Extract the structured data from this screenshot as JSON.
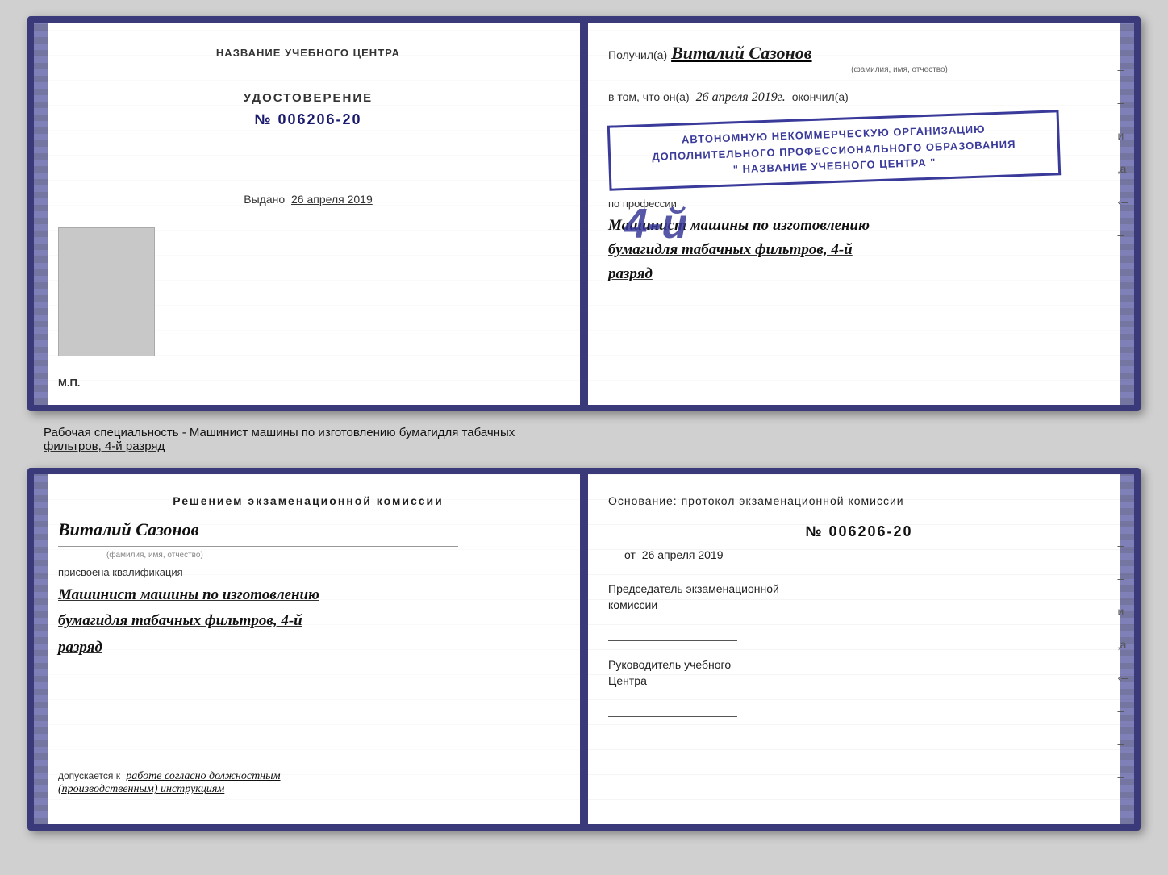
{
  "page": {
    "background_color": "#d0d0d0"
  },
  "top_document": {
    "left_page": {
      "center_label": "НАЗВАНИЕ УЧЕБНОГО ЦЕНТРА",
      "udostoverenie_title": "УДОСТОВЕРЕНИЕ",
      "number": "№ 006206-20",
      "vydano_prefix": "Выдано",
      "vydano_date": "26 апреля 2019",
      "mp_label": "М.П."
    },
    "right_page": {
      "poluchil_prefix": "Получил(а)",
      "poluchil_name": "Виталий Сазонов",
      "fio_subtitle": "(фамилия, имя, отчество)",
      "vtom_prefix": "в том, что он(а)",
      "vtom_date": "26 апреля 2019г.",
      "okonchil": "окончил(а)",
      "stamp_line1": "АВТОНОМНУЮ НЕКОММЕРЧЕСКУЮ ОРГАНИЗАЦИЮ",
      "stamp_line2": "ДОПОЛНИТЕЛЬНОГО ПРОФЕССИОНАЛЬНОГО ОБРАЗОВАНИЯ",
      "stamp_line3": "\" НАЗВАНИЕ УЧЕБНОГО ЦЕНТРА \"",
      "big_number": "4-й",
      "profession_prefix": "по профессии",
      "profession_line1": "Машинист машины по изготовлению",
      "profession_line2": "бумагидля табачных фильтров, 4-й",
      "profession_line3": "разряд"
    }
  },
  "middle_section": {
    "line1": "Рабочая специальность - Машинист машины по изготовлению бумагидля табачных",
    "line2": "фильтров, 4-й разряд"
  },
  "bottom_document": {
    "left_page": {
      "reshen_title": "Решением  экзаменационной  комиссии",
      "fio_name": "Виталий Сазонов",
      "fio_subtitle": "(фамилия, имя, отчество)",
      "prisvoena": "присвоена квалификация",
      "kvalif_line1": "Машинист машины по изготовлению",
      "kvalif_line2": "бумагидля табачных фильтров, 4-й",
      "kvalif_line3": "разряд",
      "dopuskaetsya_prefix": "допускается к",
      "dopuskaetsya_text": "работе согласно должностным",
      "dopuskaetsya_line2": "(производственным) инструкциям"
    },
    "right_page": {
      "osnovanie": "Основание: протокол экзаменационной  комиссии",
      "protocol_number": "№  006206-20",
      "ot_prefix": "от",
      "ot_date": "26 апреля 2019",
      "predsedatel_line1": "Председатель экзаменационной",
      "predsedatel_line2": "комиссии",
      "rukovoditel_line1": "Руководитель учебного",
      "rukovoditel_line2": "Центра"
    }
  }
}
